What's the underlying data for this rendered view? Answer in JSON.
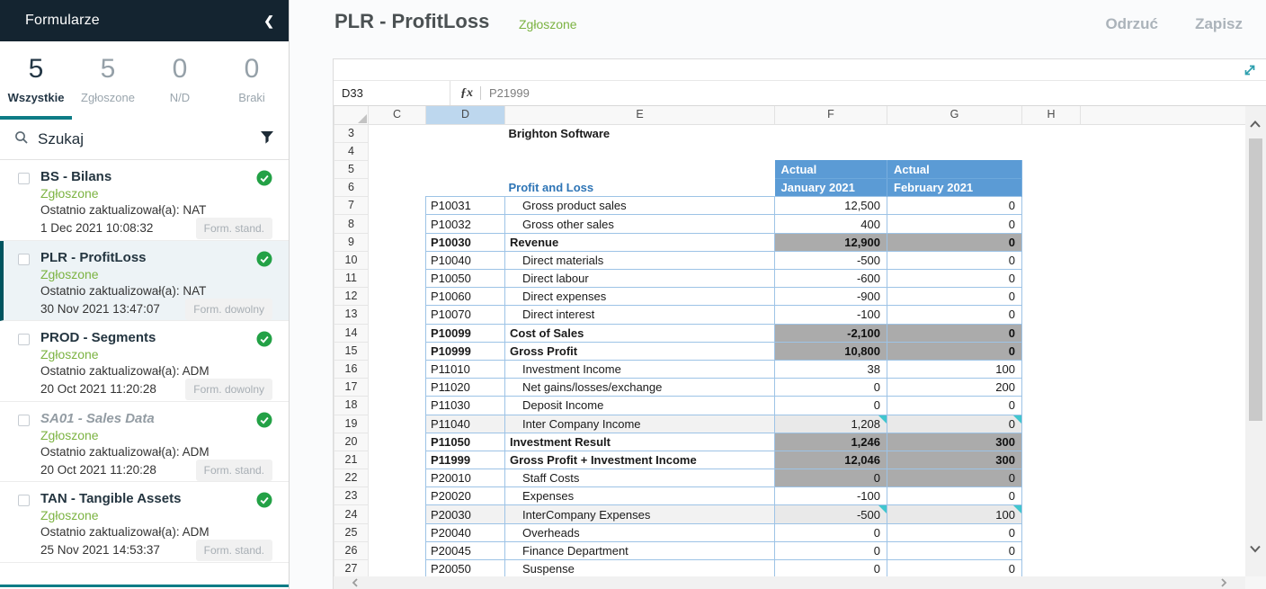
{
  "colors": {
    "accent_teal": "#0e7c86",
    "dark_header": "#142430",
    "status_green": "#7cb342",
    "check_green": "#23a146",
    "header_blue": "#5b9bd5",
    "title_blue": "#2e75b6",
    "total_gray": "#ababab",
    "comment_teal": "#41c6ce",
    "selected_col": "#bdd7ee"
  },
  "sidebar": {
    "title": "Formularze",
    "collapse_icon": "chevron-left",
    "stats": [
      {
        "count": "5",
        "label": "Wszystkie",
        "active": true
      },
      {
        "count": "5",
        "label": "Zgłoszone",
        "active": false
      },
      {
        "count": "0",
        "label": "N/D",
        "active": false
      },
      {
        "count": "0",
        "label": "Braki",
        "active": false
      }
    ],
    "search_placeholder": "Szukaj",
    "items": [
      {
        "title": "BS - Bilans",
        "status": "Zgłoszone",
        "updated": "Ostatnio zaktualizował(a): NAT",
        "date": "1 Dec 2021 10:08:32",
        "badge": "Form. stand.",
        "selected": false,
        "muted": false
      },
      {
        "title": "PLR - ProfitLoss",
        "status": "Zgłoszone",
        "updated": "Ostatnio zaktualizował(a): NAT",
        "date": "30 Nov 2021 13:47:07",
        "badge": "Form. dowolny",
        "selected": true,
        "muted": false
      },
      {
        "title": "PROD - Segments",
        "status": "Zgłoszone",
        "updated": "Ostatnio zaktualizował(a): ADM",
        "date": "20 Oct 2021 11:20:28",
        "badge": "Form. dowolny",
        "selected": false,
        "muted": false
      },
      {
        "title": "SA01 - Sales Data",
        "status": "Zgłoszone",
        "updated": "Ostatnio zaktualizował(a): ADM",
        "date": "20 Oct 2021 11:20:28",
        "badge": "Form. stand.",
        "selected": false,
        "muted": true
      },
      {
        "title": "TAN - Tangible Assets",
        "status": "Zgłoszone",
        "updated": "Ostatnio zaktualizował(a): ADM",
        "date": "25 Nov 2021 14:53:37",
        "badge": "Form. stand.",
        "selected": false,
        "muted": false
      }
    ]
  },
  "header": {
    "title": "PLR - ProfitLoss",
    "status": "Zgłoszone",
    "reject_label": "Odrzuć",
    "save_label": "Zapisz"
  },
  "sheet": {
    "name_box": "D33",
    "fx_label": "ƒx",
    "formula": "P21999",
    "columns": [
      "C",
      "D",
      "E",
      "F",
      "G",
      "H"
    ],
    "selected_column": "D",
    "first_row_number": 3,
    "company_name": "Brighton Software",
    "table_title": "Profit and Loss",
    "period_headers": [
      {
        "top": "Actual",
        "bottom": "January 2021"
      },
      {
        "top": "Actual",
        "bottom": "February 2021"
      }
    ],
    "rows": [
      {
        "code": "P10031",
        "label": "Gross product sales",
        "jan": "12,500",
        "feb": "0",
        "style": "detail"
      },
      {
        "code": "P10032",
        "label": "Gross other sales",
        "jan": "400",
        "feb": "0",
        "style": "detail"
      },
      {
        "code": "P10030",
        "label": "Revenue",
        "jan": "12,900",
        "feb": "0",
        "style": "total"
      },
      {
        "code": "P10040",
        "label": "Direct materials",
        "jan": "-500",
        "feb": "0",
        "style": "detail"
      },
      {
        "code": "P10050",
        "label": "Direct labour",
        "jan": "-600",
        "feb": "0",
        "style": "detail"
      },
      {
        "code": "P10060",
        "label": "Direct expenses",
        "jan": "-900",
        "feb": "0",
        "style": "detail"
      },
      {
        "code": "P10070",
        "label": "Direct interest",
        "jan": "-100",
        "feb": "0",
        "style": "detail"
      },
      {
        "code": "P10099",
        "label": "Cost of Sales",
        "jan": "-2,100",
        "feb": "0",
        "style": "total"
      },
      {
        "code": "P10999",
        "label": "Gross Profit",
        "jan": "10,800",
        "feb": "0",
        "style": "total"
      },
      {
        "code": "P11010",
        "label": "Investment Income",
        "jan": "38",
        "feb": "100",
        "style": "detail"
      },
      {
        "code": "P11020",
        "label": "Net gains/losses/exchange",
        "jan": "0",
        "feb": "200",
        "style": "detail"
      },
      {
        "code": "P11030",
        "label": "Deposit Income",
        "jan": "0",
        "feb": "0",
        "style": "detail"
      },
      {
        "code": "P11040",
        "label": "Inter Company Income",
        "jan": "1,208",
        "feb": "0",
        "style": "comment"
      },
      {
        "code": "P11050",
        "label": "Investment Result",
        "jan": "1,246",
        "feb": "300",
        "style": "total"
      },
      {
        "code": "P11999",
        "label": "Gross Profit + Investment Income",
        "jan": "12,046",
        "feb": "300",
        "style": "total"
      },
      {
        "code": "P20010",
        "label": "Staff Costs",
        "jan": "0",
        "feb": "0",
        "style": "gray"
      },
      {
        "code": "P20020",
        "label": "Expenses",
        "jan": "-100",
        "feb": "0",
        "style": "detail"
      },
      {
        "code": "P20030",
        "label": "InterCompany Expenses",
        "jan": "-500",
        "feb": "100",
        "style": "comment"
      },
      {
        "code": "P20040",
        "label": "Overheads",
        "jan": "0",
        "feb": "0",
        "style": "detail"
      },
      {
        "code": "P20045",
        "label": "Finance Department",
        "jan": "0",
        "feb": "0",
        "style": "detail"
      },
      {
        "code": "P20050",
        "label": "Suspense",
        "jan": "0",
        "feb": "0",
        "style": "detail"
      }
    ]
  }
}
